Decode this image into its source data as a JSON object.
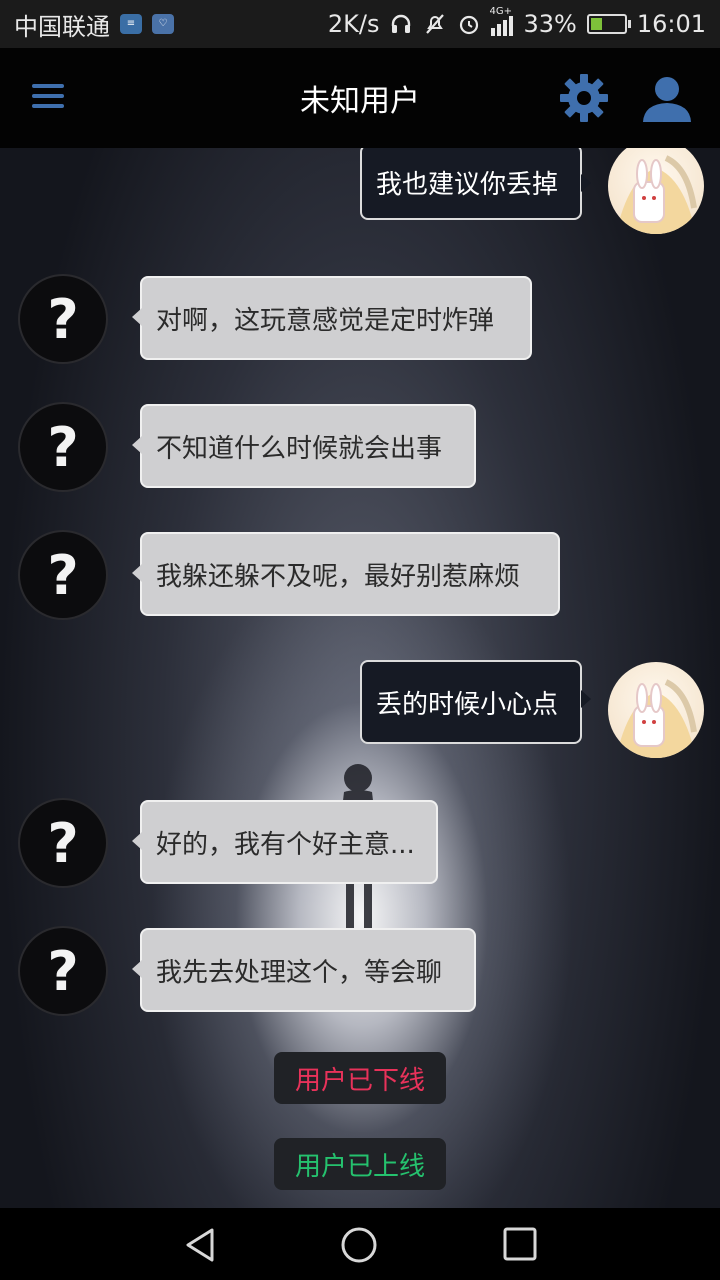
{
  "status_bar": {
    "carrier": "中国联通",
    "net_speed": "2K/s",
    "network": "4G+",
    "battery": "33%",
    "battery_level": 0.33,
    "time": "16:01",
    "icons": [
      "app-badge-icon",
      "pulse-icon",
      "headphones-icon",
      "mute-icon",
      "alarm-icon",
      "signal-icon",
      "battery-icon"
    ]
  },
  "app_bar": {
    "title": "未知用户",
    "icons": [
      "menu-icon",
      "settings-gear-icon",
      "user-profile-icon"
    ],
    "accent_color": "#3f6fad"
  },
  "messages": [
    {
      "sender": "me",
      "text": "我也建议你丢掉"
    },
    {
      "sender": "unknown",
      "text": "对啊，这玩意感觉是定时炸弹"
    },
    {
      "sender": "unknown",
      "text": "不知道什么时候就会出事"
    },
    {
      "sender": "unknown",
      "text": "我躲还躲不及呢，最好别惹麻烦"
    },
    {
      "sender": "me",
      "text": "丢的时候小心点"
    },
    {
      "sender": "unknown",
      "text": "好的，我有个好主意..."
    },
    {
      "sender": "unknown",
      "text": "我先去处理这个，等会聊"
    }
  ],
  "unknown_avatar_glyph": "?",
  "system_notices": [
    {
      "text": "用户已下线",
      "color": "#e8325a"
    },
    {
      "text": "用户已上线",
      "color": "#25c26e"
    }
  ],
  "nav_bar": {
    "icons": [
      "back-icon",
      "home-icon",
      "recent-apps-icon"
    ]
  }
}
